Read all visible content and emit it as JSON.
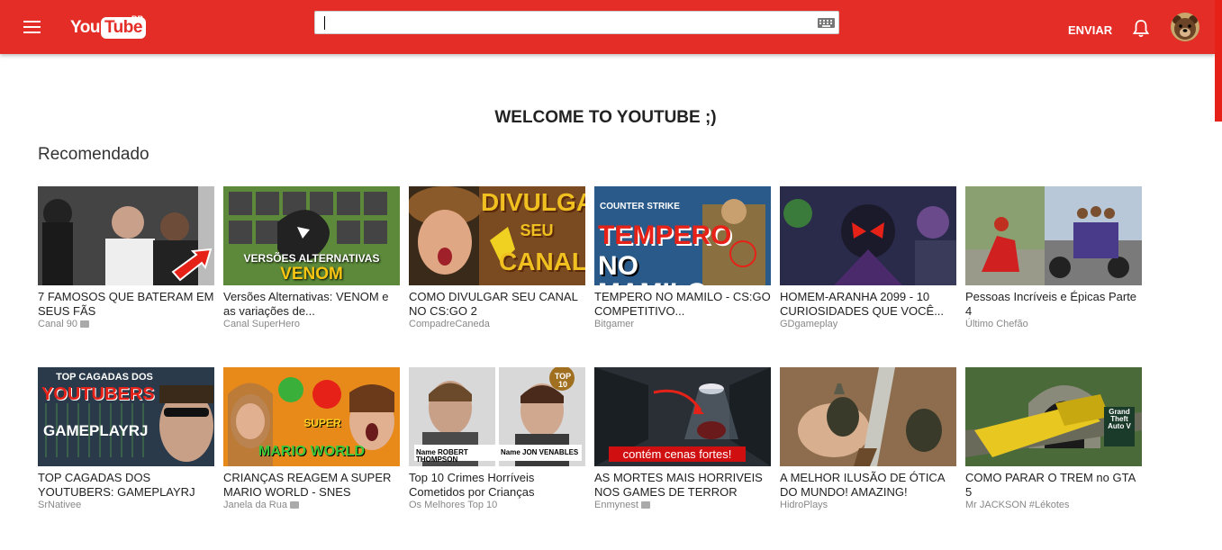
{
  "header": {
    "logo_you": "You",
    "logo_tube": "Tube",
    "country": "BR",
    "search_value": "",
    "upload_label": "ENVIAR",
    "brand_color": "#e52d27"
  },
  "icons": {
    "menu": "hamburger-menu-icon",
    "keyboard": "keyboard-icon",
    "notifications": "bell-icon",
    "avatar": "bear-avatar"
  },
  "main": {
    "welcome": "WELCOME TO YOUTUBE ;)",
    "section_title": "Recomendado",
    "videos": [
      {
        "title": "7 FAMOSOS QUE BATERAM EM SEUS FÃS",
        "channel": "Canal 90",
        "verified": true
      },
      {
        "title": "Versões Alternativas: VENOM e as variações de...",
        "channel": "Canal SuperHero",
        "verified": false,
        "thumb_text_1": "VERSÕES ALTERNATIVAS",
        "thumb_text_2": "VENOM"
      },
      {
        "title": "COMO DIVULGAR SEU CANAL NO CS:GO 2",
        "channel": "CompadreCaneda",
        "verified": false,
        "thumb_text_1": "DIVULGAR",
        "thumb_text_2": "SEU",
        "thumb_text_3": "CANAL"
      },
      {
        "title": "TEMPERO NO MAMILO - CS:GO COMPETITIVO...",
        "channel": "Bitgamer",
        "verified": false,
        "thumb_text_1": "COUNTER STRIKE",
        "thumb_text_2": "TEMPERO",
        "thumb_text_3": "NO MAMILO"
      },
      {
        "title": "HOMEM-ARANHA 2099 - 10 CURIOSIDADES QUE VOCÊ...",
        "channel": "GDgameplay",
        "verified": false
      },
      {
        "title": "Pessoas Incríveis e Épicas Parte 4",
        "channel": "Último Chefão",
        "verified": false
      },
      {
        "title": "TOP CAGADAS DOS YOUTUBERS: GAMEPLAYRJ",
        "channel": "SrNativee",
        "verified": false,
        "thumb_text_1": "TOP CAGADAS DOS",
        "thumb_text_2": "YOUTUBERS",
        "thumb_text_3": "GAMEPLAYRJ"
      },
      {
        "title": "CRIANÇAS REAGEM A SUPER MARIO WORLD - SNES",
        "channel": "Janela da Rua",
        "verified": true,
        "thumb_text_1": "SUPER",
        "thumb_text_2": "MARIO WORLD"
      },
      {
        "title": "Top 10 Crimes Horríveis Cometidos por Crianças",
        "channel": "Os Melhores Top 10",
        "verified": false,
        "thumb_text_1": "TOP 10",
        "thumb_text_2": "Name ROBERT THOMPSON",
        "thumb_text_3": "Name JON VENABLES"
      },
      {
        "title": "AS MORTES MAIS HORRIVEIS NOS GAMES DE TERROR",
        "channel": "Enmynest",
        "verified": true,
        "thumb_text_1": "contém cenas fortes!"
      },
      {
        "title": "A MELHOR ILUSÃO DE ÓTICA DO MUNDO! AMAZING!",
        "channel": "HidroPlays",
        "verified": false
      },
      {
        "title": "COMO PARAR O TREM no GTA 5",
        "channel": "Mr JACKSON #Lékotes",
        "verified": false,
        "thumb_text_1": "Grand Theft Auto V"
      }
    ]
  }
}
